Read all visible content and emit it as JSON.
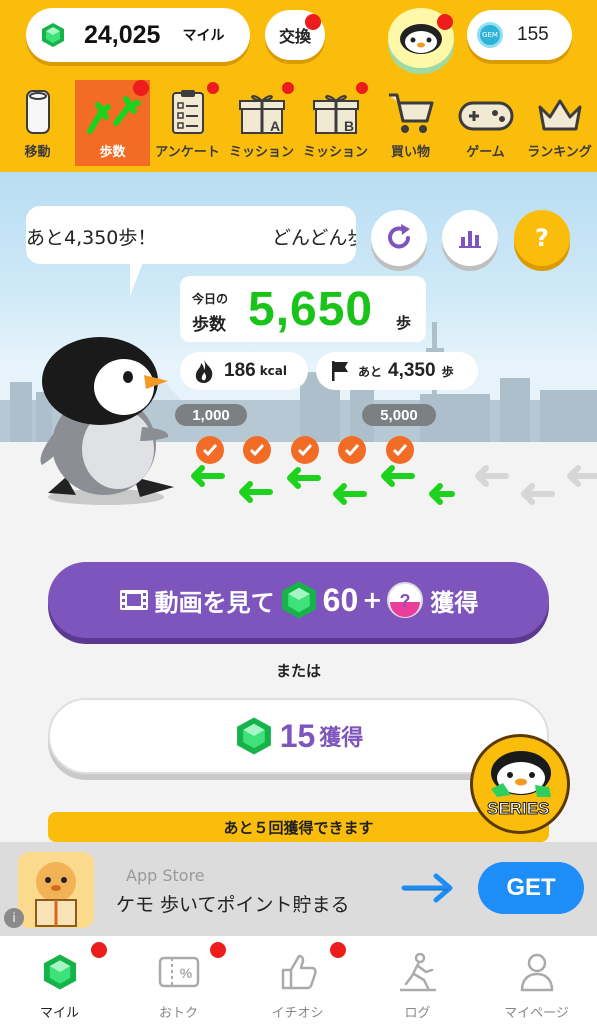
{
  "header": {
    "miles_value": "24,025",
    "miles_unit": "マイル",
    "exchange_label": "交換",
    "coins_value": "155",
    "coin_icon_text": "GEM"
  },
  "category_tabs": [
    {
      "label": "移動",
      "icon": "phone-icon",
      "active": false
    },
    {
      "label": "歩数",
      "icon": "footprints-icon",
      "active": true
    },
    {
      "label": "アンケート",
      "icon": "clipboard-icon",
      "active": false
    },
    {
      "label": "ミッション",
      "icon": "gift-a-icon",
      "active": false
    },
    {
      "label": "ミッション",
      "icon": "gift-b-icon",
      "active": false
    },
    {
      "label": "買い物",
      "icon": "cart-icon",
      "active": false
    },
    {
      "label": "ゲーム",
      "icon": "gamepad-icon",
      "active": false
    },
    {
      "label": "ランキング",
      "icon": "crown-icon",
      "active": false
    }
  ],
  "scene": {
    "speech_line1": "あと4,350歩！",
    "speech_line2": "どんどん歩",
    "help_label": "?",
    "today_label": "今日の",
    "steps_label": "歩数",
    "steps_value": "5,650",
    "steps_unit": "歩",
    "kcal_value": "186",
    "kcal_unit": "kcal",
    "remaining_prefix": "あと",
    "remaining_value": "4,350",
    "remaining_unit": "歩",
    "milestone_1": "1,000",
    "milestone_2": "5,000",
    "completed_checks": 5
  },
  "actions": {
    "video_cta_prefix": "動画を見て",
    "video_cta_amount": "60",
    "video_cta_plus": "+",
    "video_cta_suffix": "獲得",
    "or_text": "または",
    "claim_amount": "15",
    "claim_suffix": "獲得",
    "series_label": "SERIES",
    "remaining_claims": "あと５回獲得できます"
  },
  "ad": {
    "store": "App Store",
    "text": "ケモ 歩いてポイント貯まる",
    "get_label": "GET",
    "info": "i"
  },
  "bottom_nav": [
    {
      "label": "マイル",
      "icon": "gem-icon",
      "active": true,
      "badge": true
    },
    {
      "label": "おトク",
      "icon": "coupon-icon",
      "active": false,
      "badge": true
    },
    {
      "label": "イチオシ",
      "icon": "thumbs-up-icon",
      "active": false,
      "badge": true
    },
    {
      "label": "ログ",
      "icon": "walker-icon",
      "active": false,
      "badge": false
    },
    {
      "label": "マイページ",
      "icon": "person-icon",
      "active": false,
      "badge": false
    }
  ],
  "colors": {
    "header_yellow": "#fbbd0c",
    "active_tab_orange": "#f36c25",
    "steps_green": "#19c319",
    "cta_purple": "#7e55bd",
    "get_blue": "#1d8df7",
    "badge_red": "#ee1d1d"
  }
}
